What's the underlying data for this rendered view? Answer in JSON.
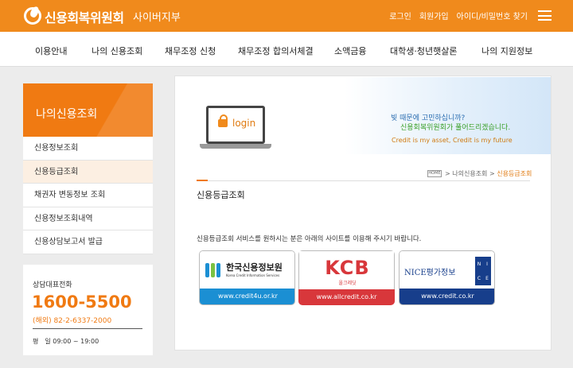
{
  "header": {
    "logo_text": "신용회복위원회",
    "logo_sub": "사이버지부",
    "util_links": [
      "로그인",
      "회원가입",
      "아이디/비밀번호 찾기"
    ]
  },
  "gnb": [
    "이용안내",
    "나의 신용조회",
    "채무조정 신청",
    "채무조정 합의서체결",
    "소액금융",
    "대학생·청년햇살론",
    "나의 지원정보"
  ],
  "sidebar": {
    "title": "나의신용조회",
    "items": [
      {
        "label": "신용정보조회"
      },
      {
        "label": "신용등급조회"
      },
      {
        "label": "채권자 변동정보 조회"
      },
      {
        "label": "신용정보조회내역"
      },
      {
        "label": "신용상담보고서 발급"
      }
    ],
    "active_index": 1
  },
  "contact": {
    "label": "상담대표전화",
    "number": "1600-5500",
    "overseas": "(해외) 82-2-6337-2000",
    "hours": "평　일 09:00 ~ 19:00"
  },
  "banner": {
    "login_label": "login",
    "question": "빚 때문에 고민하십니까?",
    "answer": "신용회복위원회가 풀어드리겠습니다.",
    "slogan": "Credit is my asset, Credit is my future"
  },
  "breadcrumb": {
    "home": "HOME",
    "sep1": " > ",
    "parent": "나의신용조회",
    "sep2": " > ",
    "current": "신용등급조회"
  },
  "content": {
    "title": "신용등급조회",
    "description": "신용등급조회 서비스를 원하시는 분은 아래의 사이트를 이용해 주시기 바랍니다."
  },
  "credit_bureaus": [
    {
      "name": "한국신용정보원",
      "name_en": "Korea Credit Information Services",
      "url": "www.credit4u.or.kr"
    },
    {
      "name": "KCB",
      "sub": "올크레딧",
      "url": "www.allcredit.co.kr"
    },
    {
      "name": "NICE평가정보",
      "box_letters": [
        "N",
        "I",
        "C",
        "E"
      ],
      "url": "www.credit.co.kr"
    }
  ],
  "colors": {
    "brand_orange": "#f08a1c",
    "kcis_blue": "#1b8fd3",
    "kcb_red": "#d8373b",
    "nice_navy": "#173e8b"
  }
}
